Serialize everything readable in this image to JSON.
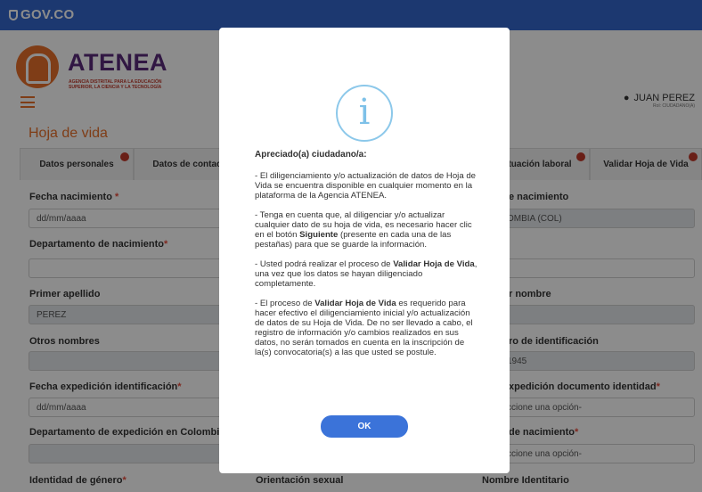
{
  "gov": {
    "logo_text": "GOV.CO"
  },
  "header": {
    "brand": "ATENEA",
    "brand_sub": "AGENCIA DISTRITAL PARA LA EDUCACIÓN SUPERIOR, LA CIENCIA Y LA TECNOLOGÍA",
    "user_name": "JUAN PEREZ",
    "user_role": "Rol: CIUDADANO(A)"
  },
  "page": {
    "title": "Hoja de vida"
  },
  "tabs": [
    {
      "label": "Datos personales"
    },
    {
      "label": "Datos de contac"
    },
    {
      "label": "tuación laboral"
    },
    {
      "label": "Validar Hoja de Vida"
    }
  ],
  "form": {
    "fecha_nacimiento_label": "Fecha nacimiento",
    "fecha_nacimiento_placeholder": "dd/mm/aaaa",
    "pais_nacimiento_label": "e nacimiento",
    "pais_nacimiento_value": "OMBIA (COL)",
    "depto_nacimiento_label": "Departamento de nacimiento",
    "primer_apellido_label": "Primer apellido",
    "primer_apellido_value": "PEREZ",
    "primer_nombre_label": "r nombre",
    "primer_nombre_value": "",
    "otros_nombres_label": "Otros nombres",
    "numero_id_label": "ro de identificación",
    "numero_id_value": "1945",
    "fecha_expedicion_label": "Fecha expedición identificación",
    "fecha_expedicion_placeholder": "dd/mm/aaaa",
    "lugar_expedicion_label": "xpedición documento identidad",
    "lugar_expedicion_value": "ccione una opción-",
    "depto_expedicion_label": "Departamento de expedición en Colombia",
    "municipio_nacimiento_label": "de nacimiento",
    "municipio_nacimiento_value": "ccione una opción-",
    "identidad_genero_label": "Identidad de género",
    "orientacion_label": "Orientación sexual",
    "nombre_identitario_label": "Nombre Identitario"
  },
  "modal": {
    "greeting": "Apreciado(a) ciudadano/a:",
    "p1": "- El diligenciamiento y/o actualización de datos de Hoja de Vida se encuentra disponible en cualquier momento en la plataforma de la Agencia ATENEA.",
    "p2_a": "- Tenga en cuenta que, al diligenciar y/o actualizar cualquier dato de su hoja de vida, es necesario hacer clic en el botón ",
    "p2_b": "Siguiente",
    "p2_c": " (presente en cada una de las pestañas) para que se guarde la información.",
    "p3_a": "- Usted podrá realizar el proceso de ",
    "p3_b": "Validar Hoja de Vida",
    "p3_c": ", una vez que los datos se hayan diligenciado completamente.",
    "p4_a": "- El proceso de ",
    "p4_b": "Validar Hoja de Vida",
    "p4_c": " es requerido para hacer efectivo el diligenciamiento inicial y/o actualización de datos de su Hoja de Vida. De no ser llevado a cabo, el registro de información y/o cambios realizados en sus datos, no serán tomados en cuenta en la inscripción de la(s) convocatoria(s) a las que usted se postule.",
    "ok_label": "OK",
    "icon": "info-icon"
  },
  "colors": {
    "gov_blue": "#3366cc",
    "accent_orange": "#e8702a",
    "ok_blue": "#3b73d9"
  }
}
